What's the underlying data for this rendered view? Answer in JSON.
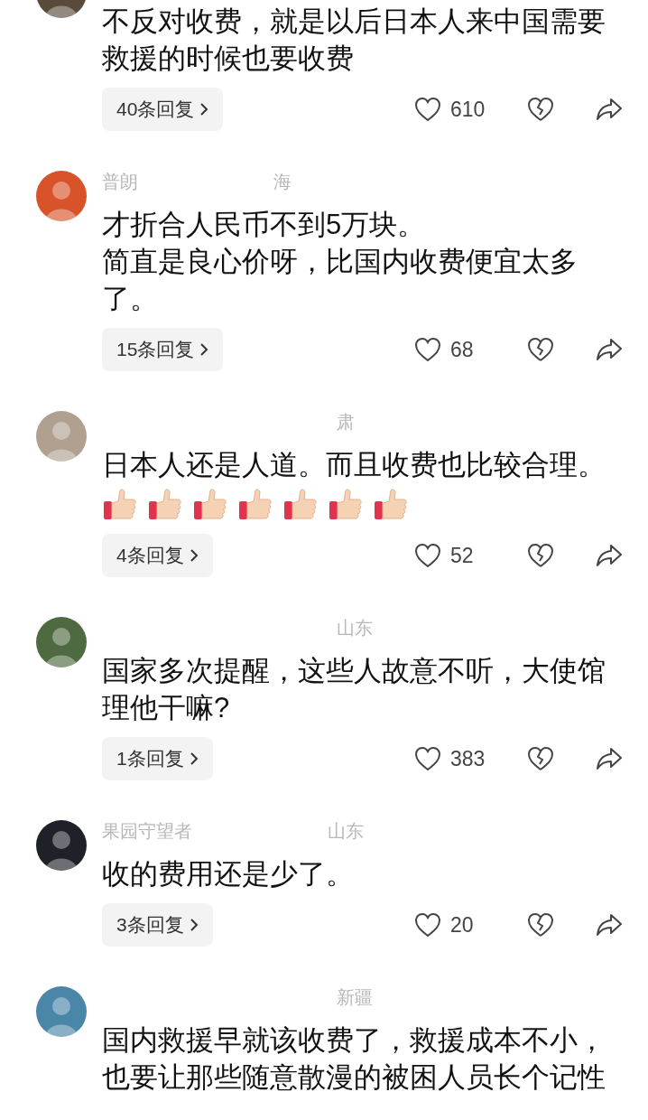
{
  "comments": [
    {
      "text": [
        "不反对收费，就是以后日本人来中国需要救援的时候也要收费"
      ],
      "replies": "40条回复",
      "likes": "610"
    },
    {
      "name": "普朗",
      "location": "海",
      "text": [
        "才折合人民币不到5万块。",
        "简直是良心价呀，比国内收费便宜太多了。"
      ],
      "replies": "15条回复",
      "likes": "68"
    },
    {
      "location": "肃",
      "text": [
        "日本人还是人道。而且收费也比较合理。"
      ],
      "reactions": [
        {
          "kind": "thumbs-up"
        },
        {
          "kind": "thumbs-up"
        },
        {
          "kind": "thumbs-up"
        },
        {
          "kind": "thumbs-up"
        },
        {
          "kind": "thumbs-up"
        },
        {
          "kind": "thumbs-up"
        },
        {
          "kind": "thumbs-up"
        }
      ],
      "replies": "4条回复",
      "likes": "52"
    },
    {
      "location": "山东",
      "text": [
        "国家多次提醒，这些人故意不听，大使馆理他干嘛?"
      ],
      "replies": "1条回复",
      "likes": "383"
    },
    {
      "name": "果园守望者",
      "location": "山东",
      "text": [
        "收的费用还是少了。"
      ],
      "replies": "3条回复",
      "likes": "20"
    },
    {
      "location": "新疆",
      "text": [
        "国内救援早就该收费了，救援成本不小，也要让那些随意散漫的被困人员长个记性"
      ]
    }
  ]
}
